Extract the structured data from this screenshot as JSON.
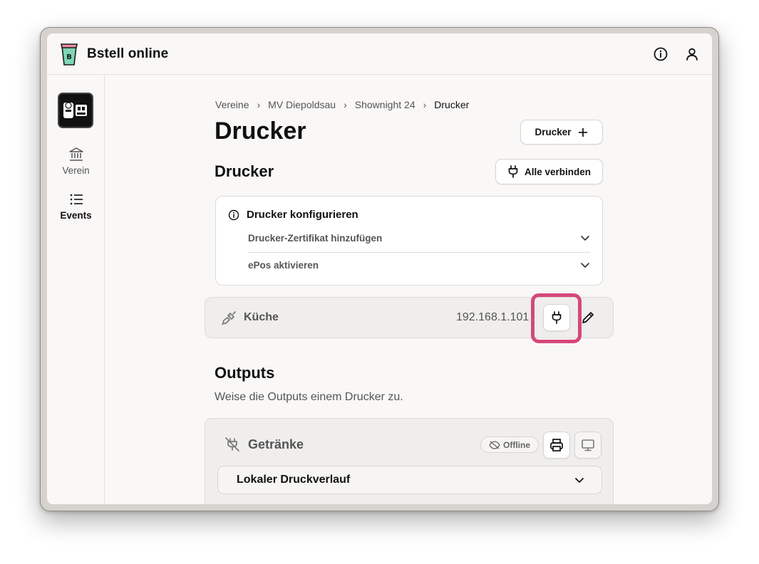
{
  "app": {
    "title": "Bstell online"
  },
  "header": {
    "info_icon": "info-icon",
    "user_icon": "user-icon"
  },
  "sidebar": {
    "items": [
      {
        "label": "Verein",
        "icon": "bank-icon"
      },
      {
        "label": "Events",
        "icon": "list-icon"
      }
    ]
  },
  "breadcrumb": [
    "Vereine",
    "MV Diepoldsau",
    "Shownight 24",
    "Drucker"
  ],
  "page": {
    "title": "Drucker",
    "add_printer_label": "Drucker"
  },
  "printers_section": {
    "title": "Drucker",
    "connect_all_label": "Alle verbinden",
    "config": {
      "title": "Drucker konfigurieren",
      "items": [
        "Drucker-Zertifikat hinzufügen",
        "ePos aktivieren"
      ]
    },
    "printers": [
      {
        "name": "Küche",
        "ip": "192.168.1.101",
        "status": "disconnected"
      }
    ]
  },
  "outputs_section": {
    "title": "Outputs",
    "subtitle": "Weise die Outputs einem Drucker zu.",
    "outputs": [
      {
        "name": "Getränke",
        "badge": "Offline",
        "selected_printer": "Lokaler Druckverlauf"
      }
    ]
  },
  "colors": {
    "highlight": "#d6477a",
    "background": "#f9f8f7"
  }
}
